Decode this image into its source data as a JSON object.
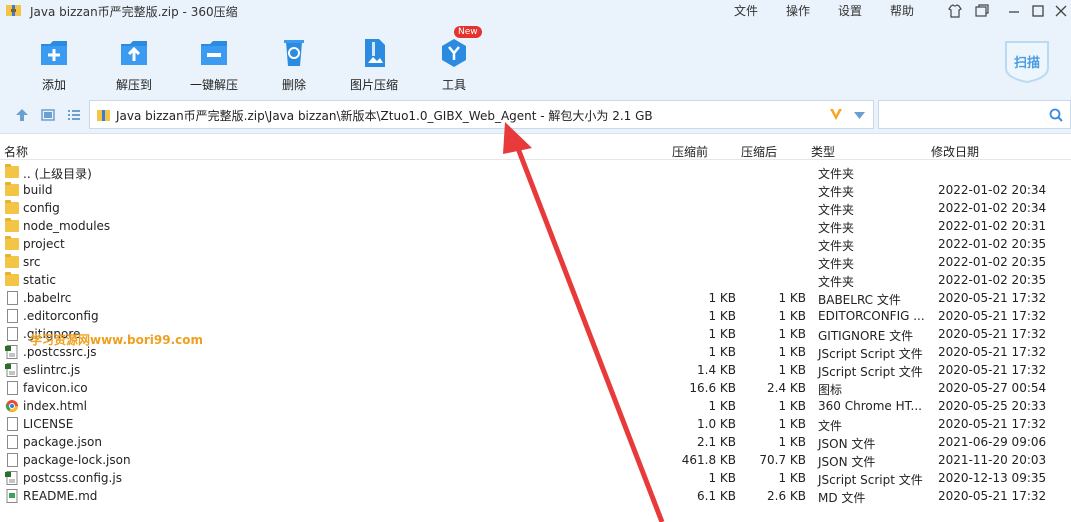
{
  "window": {
    "title": "Java bizzan币严完整版.zip - 360压缩",
    "menus": [
      "文件",
      "操作",
      "设置",
      "帮助"
    ]
  },
  "toolbar": {
    "add_label": "添加",
    "extract_to_label": "解压到",
    "one_click_extract_label": "一键解压",
    "delete_label": "删除",
    "image_compress_label": "图片压缩",
    "tools_label": "工具",
    "new_badge": "New",
    "scan_label": "扫描"
  },
  "address": {
    "path": "Java bizzan币严完整版.zip\\Java bizzan\\新版本\\Ztuo1.0_GIBX_Web_Agent - 解包大小为 2.1 GB"
  },
  "search": {
    "placeholder": ""
  },
  "columns": {
    "name": "名称",
    "before": "压缩前",
    "after": "压缩后",
    "type": "类型",
    "modified": "修改日期"
  },
  "files": [
    {
      "name": ".. (上级目录)",
      "before": "",
      "after": "",
      "type": "文件夹",
      "date": "",
      "icon": "folder-icon"
    },
    {
      "name": "build",
      "before": "",
      "after": "",
      "type": "文件夹",
      "date": "2022-01-02 20:34",
      "icon": "folder-icon"
    },
    {
      "name": "config",
      "before": "",
      "after": "",
      "type": "文件夹",
      "date": "2022-01-02 20:34",
      "icon": "folder-icon"
    },
    {
      "name": "node_modules",
      "before": "",
      "after": "",
      "type": "文件夹",
      "date": "2022-01-02 20:31",
      "icon": "folder-icon"
    },
    {
      "name": "project",
      "before": "",
      "after": "",
      "type": "文件夹",
      "date": "2022-01-02 20:35",
      "icon": "folder-icon"
    },
    {
      "name": "src",
      "before": "",
      "after": "",
      "type": "文件夹",
      "date": "2022-01-02 20:35",
      "icon": "folder-icon"
    },
    {
      "name": "static",
      "before": "",
      "after": "",
      "type": "文件夹",
      "date": "2022-01-02 20:35",
      "icon": "folder-icon"
    },
    {
      "name": ".babelrc",
      "before": "1 KB",
      "after": "1 KB",
      "type": "BABELRC 文件",
      "date": "2020-05-21 17:32",
      "icon": "file-icon"
    },
    {
      "name": ".editorconfig",
      "before": "1 KB",
      "after": "1 KB",
      "type": "EDITORCONFIG ...",
      "date": "2020-05-21 17:32",
      "icon": "file-icon"
    },
    {
      "name": ".gitignore",
      "before": "1 KB",
      "after": "1 KB",
      "type": "GITIGNORE 文件",
      "date": "2020-05-21 17:32",
      "icon": "file-icon"
    },
    {
      "name": ".postcssrc.js",
      "before": "1 KB",
      "after": "1 KB",
      "type": "JScript Script 文件",
      "date": "2020-05-21 17:32",
      "icon": "js-file-icon"
    },
    {
      "name": "eslintrc.js",
      "before": "1.4 KB",
      "after": "1 KB",
      "type": "JScript Script 文件",
      "date": "2020-05-21 17:32",
      "icon": "js-file-icon"
    },
    {
      "name": "favicon.ico",
      "before": "16.6 KB",
      "after": "2.4 KB",
      "type": "图标",
      "date": "2020-05-27 00:54",
      "icon": "file-icon"
    },
    {
      "name": "index.html",
      "before": "1 KB",
      "after": "1 KB",
      "type": "360 Chrome HT...",
      "date": "2020-05-25 20:33",
      "icon": "chrome-html-icon"
    },
    {
      "name": "LICENSE",
      "before": "1.0 KB",
      "after": "1 KB",
      "type": "文件",
      "date": "2020-05-21 17:32",
      "icon": "file-icon"
    },
    {
      "name": "package.json",
      "before": "2.1 KB",
      "after": "1 KB",
      "type": "JSON 文件",
      "date": "2021-06-29 09:06",
      "icon": "file-icon"
    },
    {
      "name": "package-lock.json",
      "before": "461.8 KB",
      "after": "70.7 KB",
      "type": "JSON 文件",
      "date": "2021-11-20 20:03",
      "icon": "file-icon"
    },
    {
      "name": "postcss.config.js",
      "before": "1 KB",
      "after": "1 KB",
      "type": "JScript Script 文件",
      "date": "2020-12-13 09:35",
      "icon": "js-file-icon"
    },
    {
      "name": "README.md",
      "before": "6.1 KB",
      "after": "2.6 KB",
      "type": "MD 文件",
      "date": "2020-05-21 17:32",
      "icon": "md-file-icon"
    }
  ],
  "watermark": "学习资源网www.bori99.com",
  "colors": {
    "chrome_bg": "#eaf3fb",
    "accent_blue": "#2a8be0",
    "arrow_red": "#e83a3a",
    "folder_yellow": "#f3c547",
    "watermark_orange": "#f0a020"
  }
}
